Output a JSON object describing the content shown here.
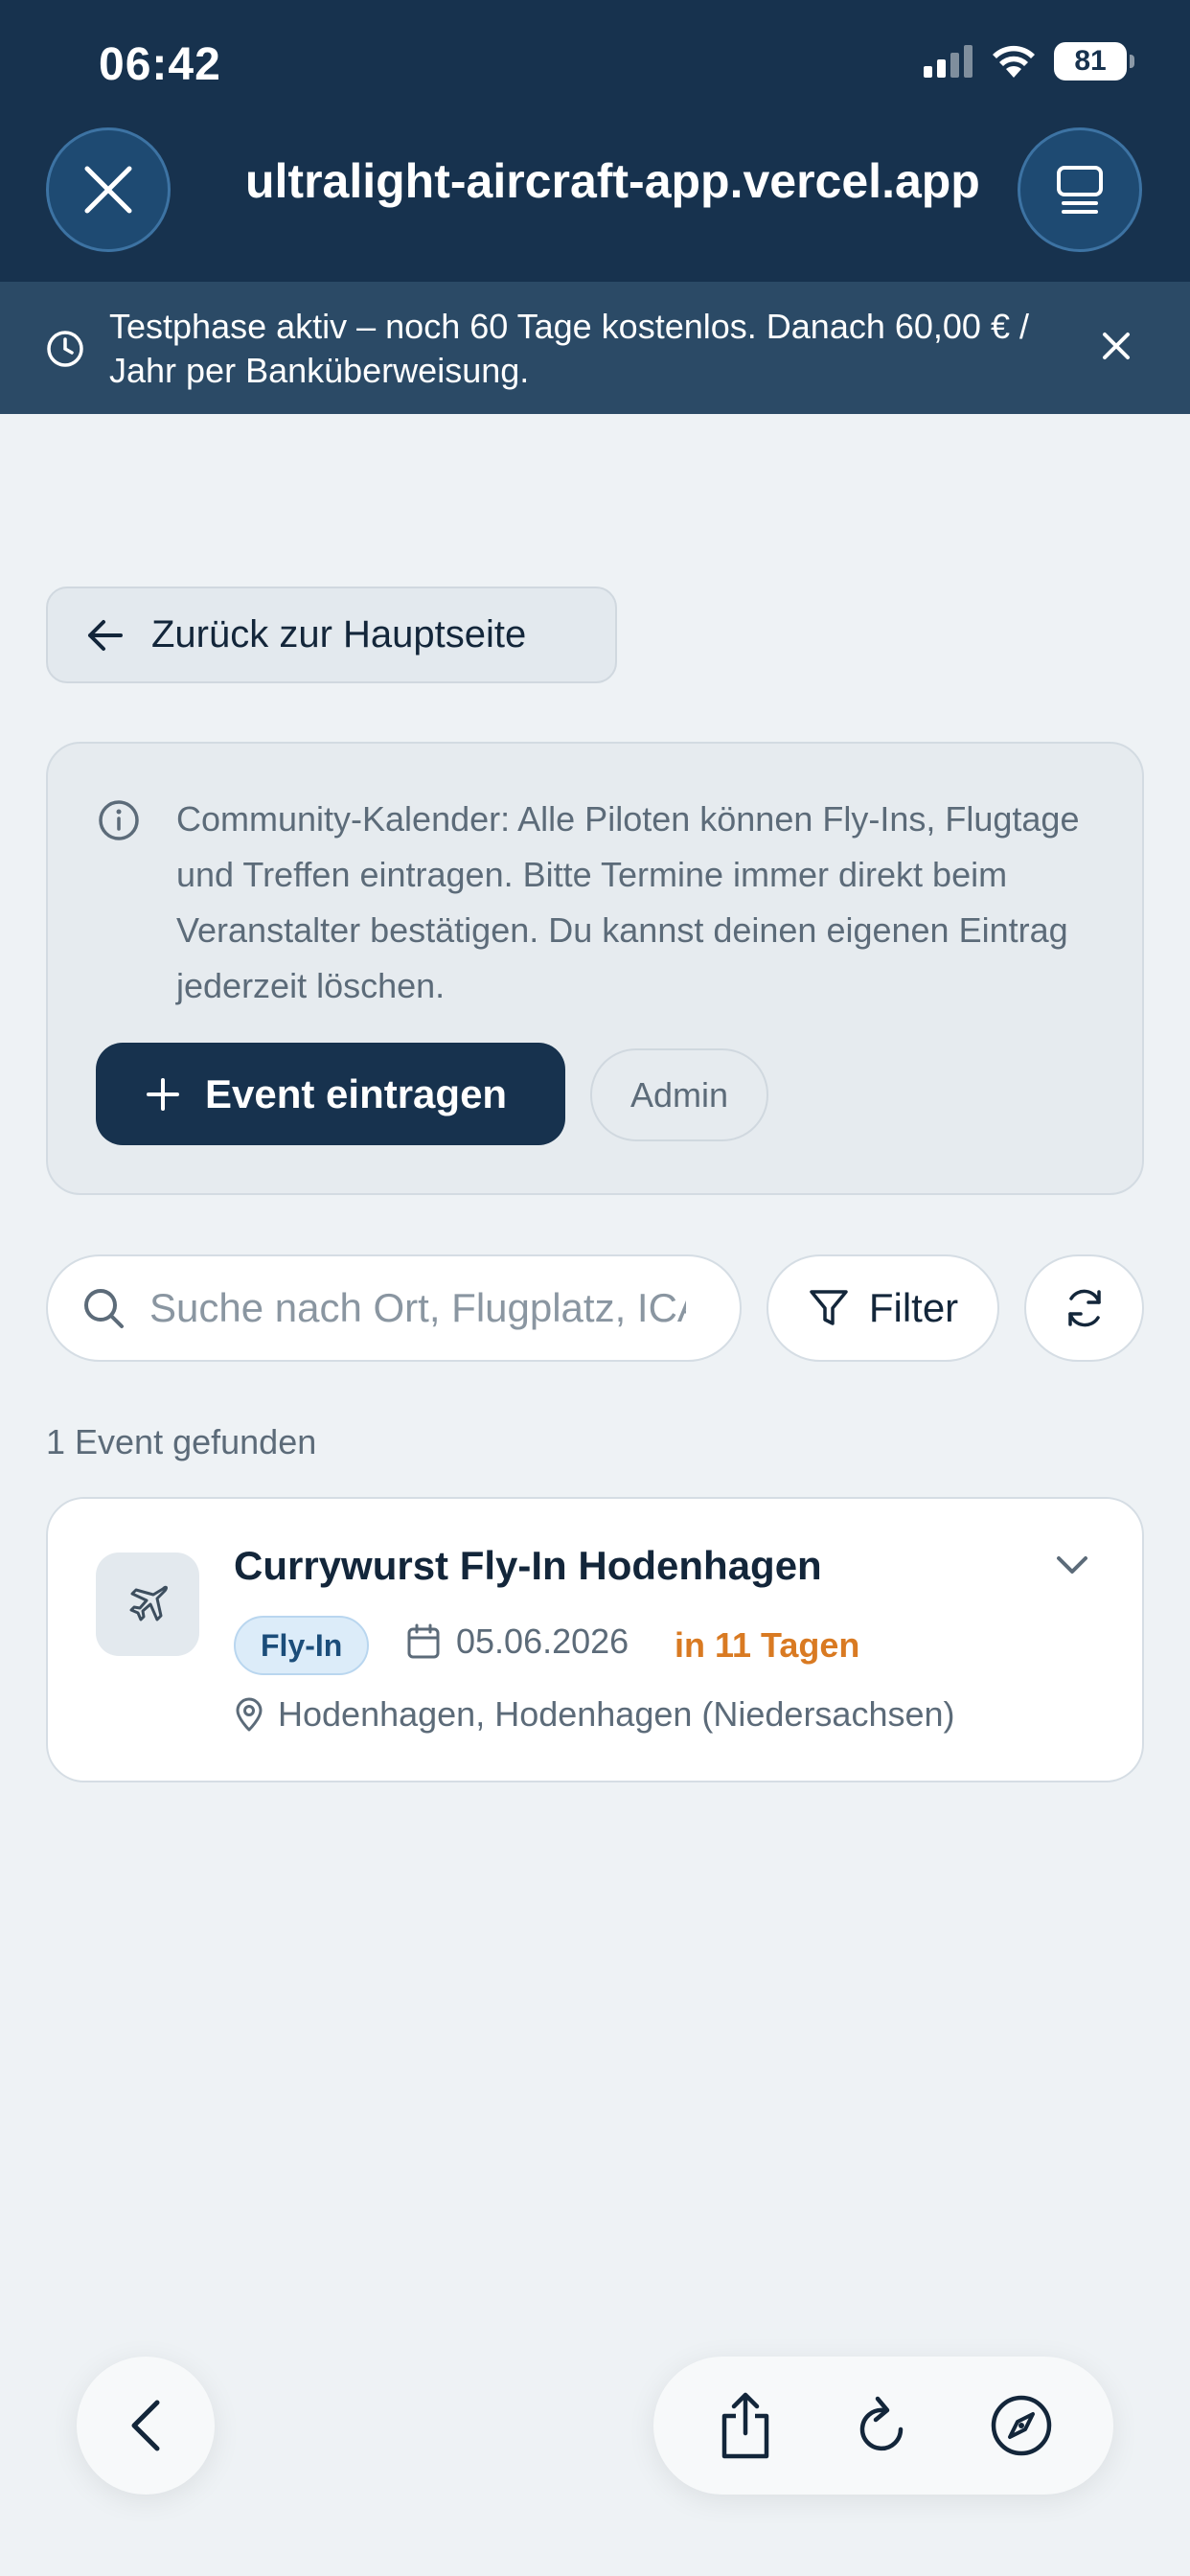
{
  "status_bar": {
    "time": "06:42",
    "battery": "81"
  },
  "browser": {
    "url": "ultralight-aircraft-app.vercel.app"
  },
  "banner": {
    "text": "Testphase aktiv – noch 60 Tage kostenlos. Danach 60,00 € / Jahr per Banküberweisung."
  },
  "back_button": {
    "label": "Zurück zur Hauptseite"
  },
  "info": {
    "text": "Community-Kalender: Alle Piloten können Fly-Ins, Flugtage und Treffen eintragen. Bitte Termine immer direkt beim Veranstalter bestätigen. Du kannst deinen eigenen Eintrag jederzeit löschen.",
    "add_event_label": "Event eintragen",
    "admin_label": "Admin"
  },
  "search": {
    "placeholder": "Suche nach Ort, Flugplatz, ICAO",
    "filter_label": "Filter"
  },
  "results": {
    "count_text": "1 Event gefunden"
  },
  "events": [
    {
      "title": "Currywurst Fly-In Hodenhagen",
      "tag": "Fly-In",
      "date": "05.06.2026",
      "countdown": "in 11 Tagen",
      "location": "Hodenhagen, Hodenhagen (Niedersachsen)"
    }
  ],
  "colors": {
    "header": "#17324e",
    "banner": "#2b4a66",
    "accent_orange": "#d97a22",
    "tag_bg": "#dcecf9"
  },
  "icons": [
    "close-icon",
    "tabs-icon",
    "clock-icon",
    "arrow-left-icon",
    "info-icon",
    "plus-icon",
    "search-icon",
    "filter-icon",
    "refresh-icon",
    "plane-icon",
    "chevron-down-icon",
    "calendar-icon",
    "map-pin-icon",
    "share-icon",
    "reload-icon",
    "compass-icon"
  ]
}
